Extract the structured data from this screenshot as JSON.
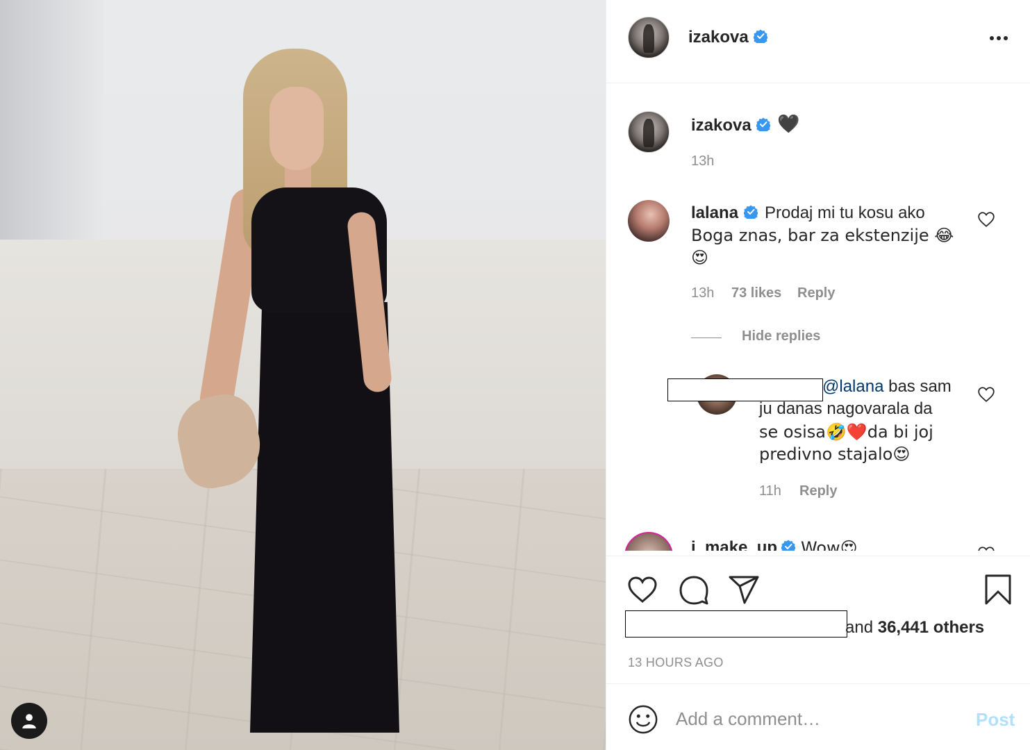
{
  "post": {
    "author": "izakova",
    "caption_emoji": "🖤",
    "caption_time": "13h"
  },
  "comments": [
    {
      "username": "lalana",
      "text_line1": "Prodaj mi tu kosu ako",
      "text_line2": "Boga znas, bar za ekstenzije 😂",
      "text_line3": "😍",
      "time": "13h",
      "likes": "73 likes",
      "reply_label": "Reply",
      "hide_replies_label": "Hide replies",
      "replies": [
        {
          "mention": "@lalana",
          "text_line1": " bas sam",
          "text_line2": "ju danas nagovarala da",
          "text_line3": "se osisa🤣❤️da bi joj",
          "text_line4": "predivno stajalo😍",
          "time": "11h",
          "reply_label": "Reply"
        }
      ]
    },
    {
      "username": "i_make_up",
      "text": "Wow😍"
    }
  ],
  "likes": {
    "suffix_text": "and ",
    "count": "36,441 others"
  },
  "timestamp": "13 HOURS AGO",
  "add_comment": {
    "placeholder": "Add a comment…",
    "post_label": "Post"
  },
  "colors": {
    "verified": "#3897f0",
    "post_disabled": "#b2dffc",
    "muted": "#8e8e8e",
    "mention": "#00376b"
  },
  "icons": {
    "like": "heart-icon",
    "comment": "comment-icon",
    "share": "paper-plane-icon",
    "save": "bookmark-icon",
    "more": "more-options-icon",
    "tagged_user": "user-tag-icon",
    "emoji": "emoji-icon"
  }
}
